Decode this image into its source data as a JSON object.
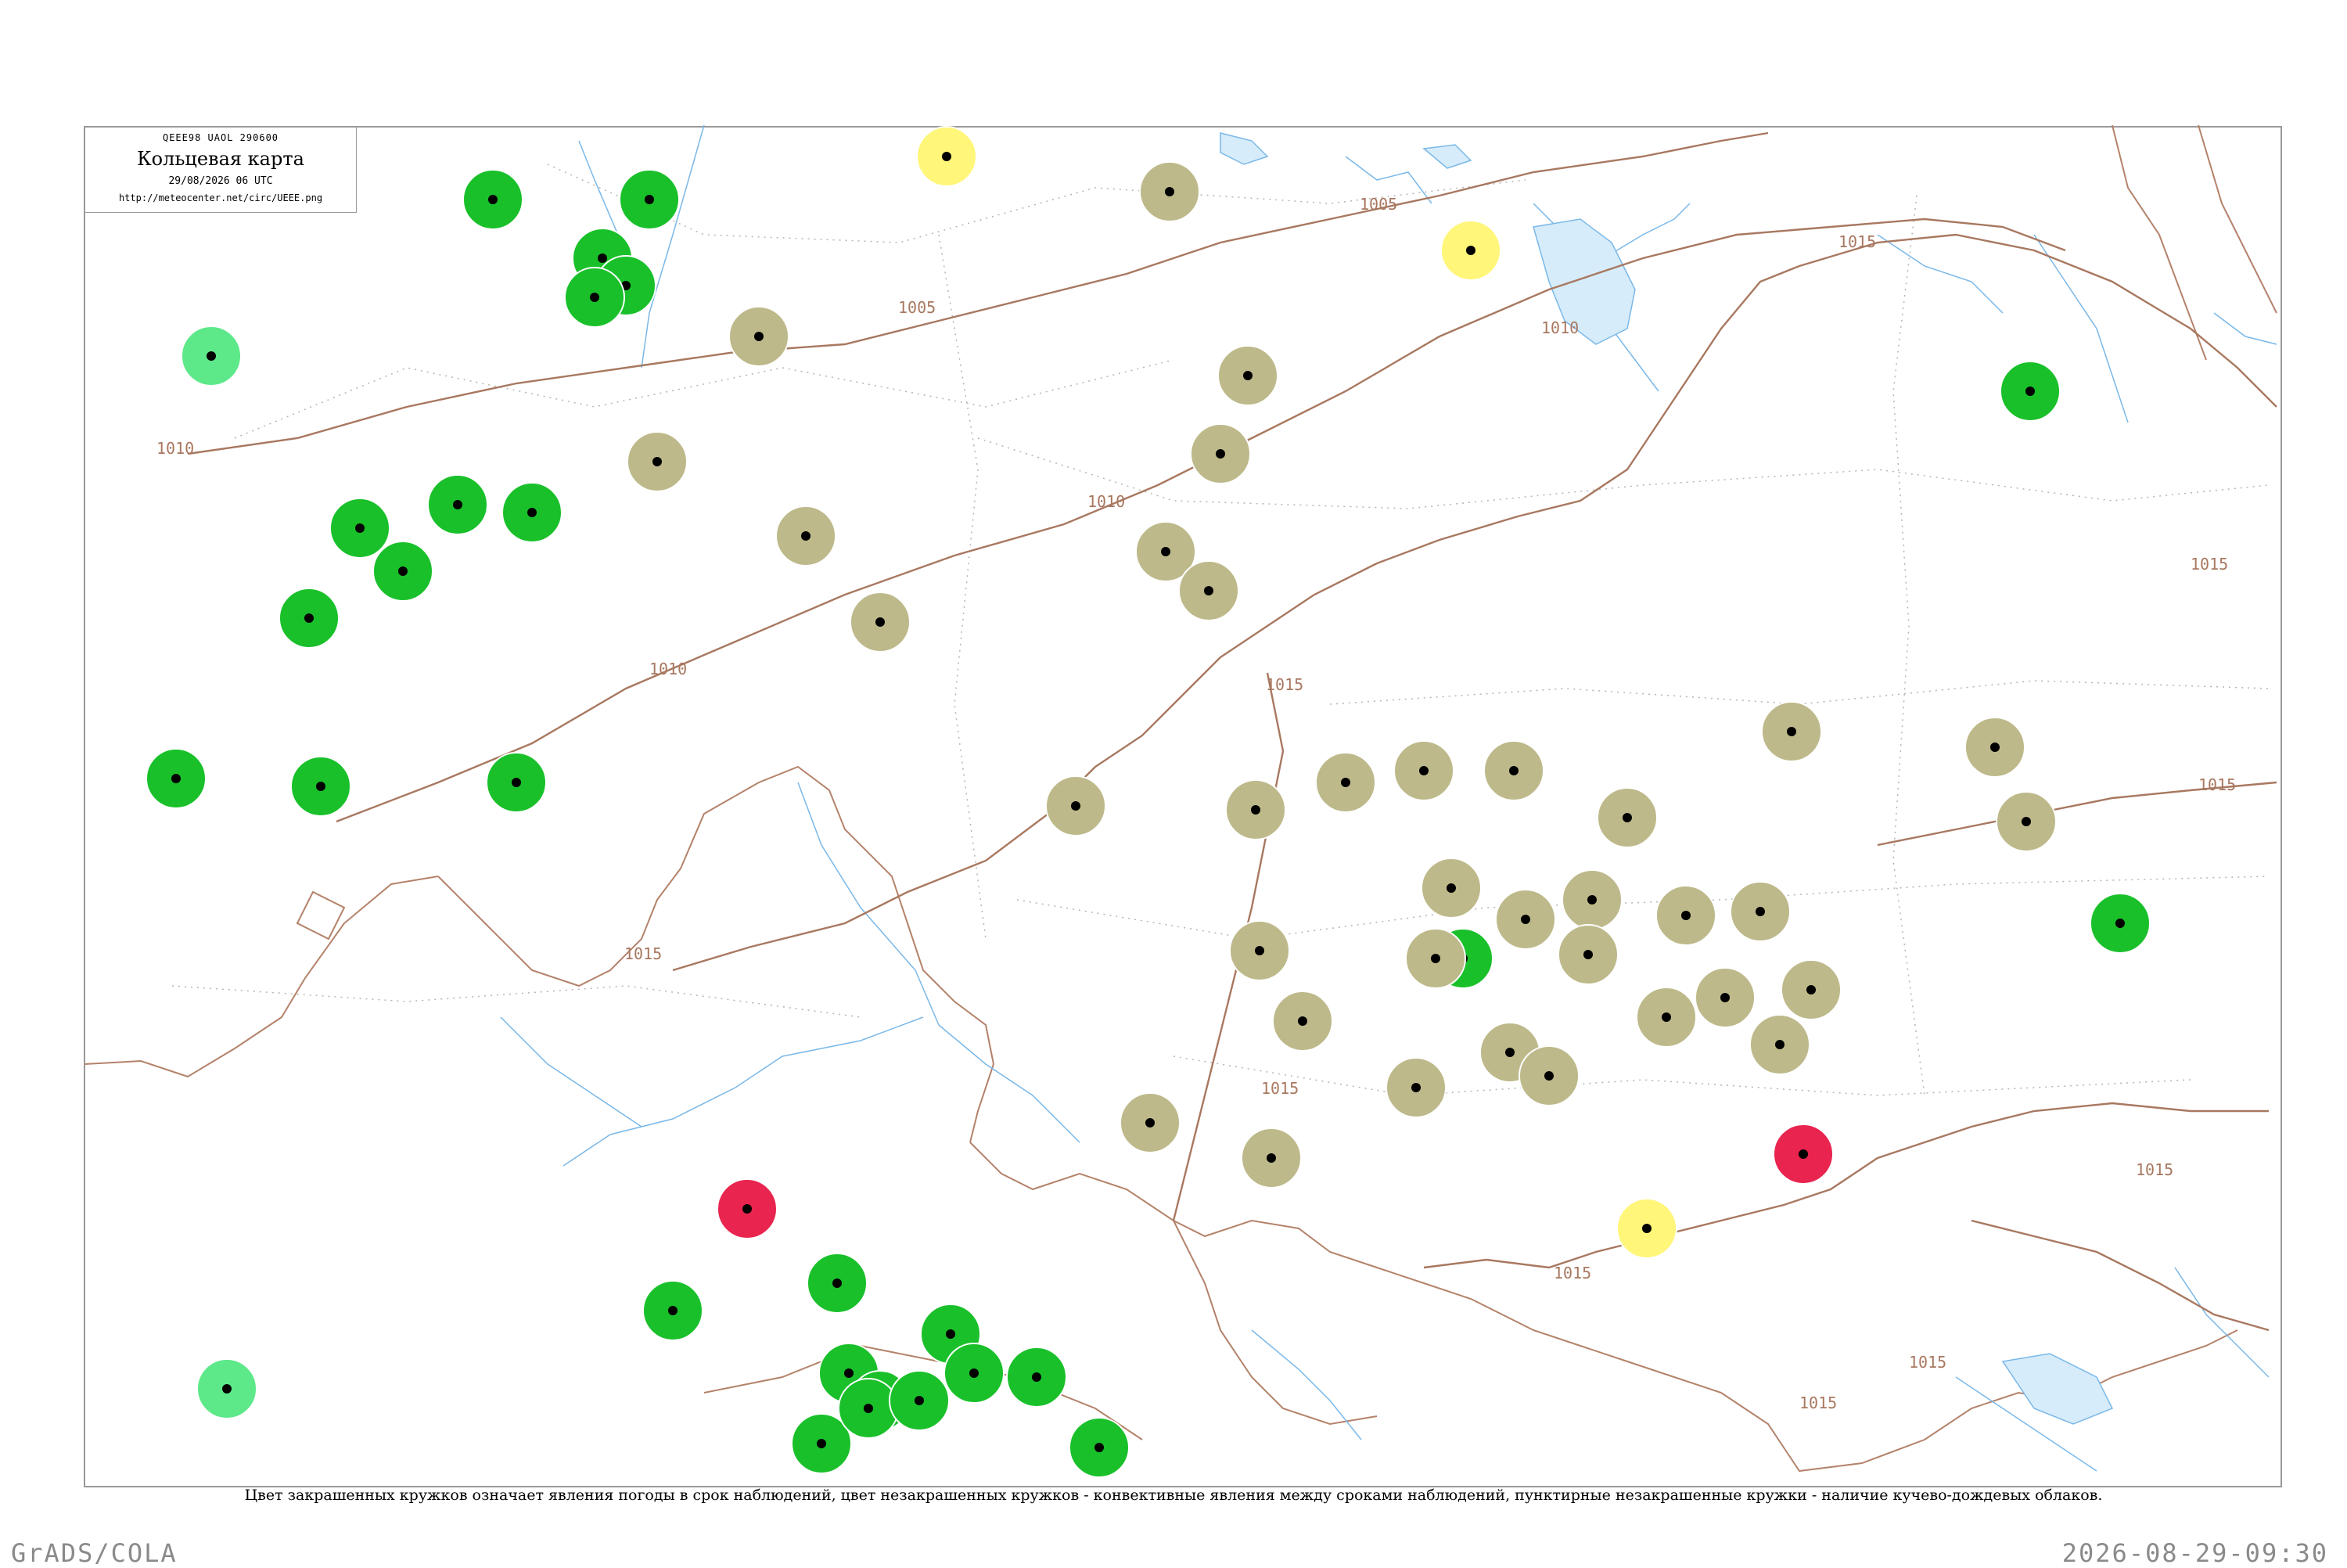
{
  "header": {
    "code": "QEEE98  UAOL  290600",
    "title": "Кольцевая карта",
    "time": "29/08/2026 06 UTC",
    "url": "http://meteocenter.net/circ/UEEE.png"
  },
  "caption": "Цвет закрашенных кружков означает явления погоды в срок наблюдений, цвет незакрашенных кружков - конвективные явления между сроками наблюдений, пунктирные незакрашенные кружки - наличие кучево-дождевых облаков.",
  "footer": {
    "left": "GrADS/COLA",
    "right": "2026-08-29-09:30"
  },
  "colors": {
    "rain": "#19c02a",
    "shower_light": "#5de88a",
    "fog_haze": "#bdb98a",
    "heat": "#fff67a",
    "severe": "#e8244f",
    "isobar": "#a87860",
    "river": "#7ab8e8",
    "border": "#a0a0a0"
  },
  "isobar_labels": [
    "1005",
    "1005",
    "1010",
    "1010",
    "1010",
    "1010",
    "1015",
    "1015",
    "1015",
    "1015",
    "1015",
    "1015",
    "1015",
    "1015",
    "1015",
    "1015"
  ],
  "stations": [
    {
      "kind": "rain",
      "t": "",
      "n": "",
      "name": ""
    },
    {
      "kind": "rain",
      "t": "",
      "n": "",
      "name": ""
    },
    {
      "kind": "rain",
      "t": "",
      "n": "",
      "name": ""
    },
    {
      "kind": "rain",
      "t": "",
      "n": "",
      "name": ""
    },
    {
      "kind": "rain",
      "t": "",
      "n": "",
      "name": ""
    },
    {
      "kind": "rain",
      "t": "",
      "n": "",
      "name": ""
    },
    {
      "kind": "rain",
      "t": "",
      "n": "",
      "name": ""
    },
    {
      "kind": "rain",
      "t": "",
      "n": "",
      "name": ""
    },
    {
      "kind": "rain",
      "t": "",
      "n": "",
      "name": ""
    },
    {
      "kind": "rain",
      "t": "",
      "n": "",
      "name": ""
    },
    {
      "kind": "rain",
      "t": "",
      "n": "",
      "name": ""
    },
    {
      "kind": "rain",
      "t": "",
      "n": "",
      "name": ""
    },
    {
      "kind": "rain",
      "t": "",
      "n": "",
      "name": ""
    },
    {
      "kind": "rain",
      "t": "",
      "n": "",
      "name": ""
    },
    {
      "kind": "rain",
      "t": "",
      "n": "",
      "name": ""
    },
    {
      "kind": "rain",
      "t": "",
      "n": "",
      "name": ""
    },
    {
      "kind": "rain",
      "t": "",
      "n": "",
      "name": ""
    },
    {
      "kind": "rain",
      "t": "",
      "n": "",
      "name": ""
    },
    {
      "kind": "rain",
      "t": "",
      "n": "",
      "name": ""
    },
    {
      "kind": "rain",
      "t": "",
      "n": "",
      "name": ""
    },
    {
      "kind": "rain",
      "t": "",
      "n": "",
      "name": ""
    },
    {
      "kind": "rain",
      "t": "",
      "n": "",
      "name": ""
    },
    {
      "kind": "rain",
      "t": "",
      "n": "",
      "name": ""
    },
    {
      "kind": "rain",
      "t": "",
      "n": "",
      "name": ""
    },
    {
      "kind": "rain",
      "t": "",
      "n": "",
      "name": ""
    },
    {
      "kind": "rain",
      "t": "",
      "n": "",
      "name": ""
    },
    {
      "kind": "rain",
      "t": "",
      "n": "",
      "name": ""
    },
    {
      "kind": "shower_light",
      "t": "",
      "n": "",
      "name": ""
    },
    {
      "kind": "shower_light",
      "t": "",
      "n": "",
      "name": ""
    },
    {
      "kind": "fog_haze",
      "t": "",
      "n": "",
      "name": ""
    },
    {
      "kind": "fog_haze",
      "t": "",
      "n": "",
      "name": ""
    },
    {
      "kind": "fog_haze",
      "t": "",
      "n": "",
      "name": ""
    },
    {
      "kind": "fog_haze",
      "t": "",
      "n": "",
      "name": ""
    },
    {
      "kind": "fog_haze",
      "t": "",
      "n": "",
      "name": ""
    },
    {
      "kind": "fog_haze",
      "t": "",
      "n": "",
      "name": ""
    },
    {
      "kind": "fog_haze",
      "t": "",
      "n": "",
      "name": ""
    },
    {
      "kind": "fog_haze",
      "t": "",
      "n": "",
      "name": ""
    },
    {
      "kind": "fog_haze",
      "t": "",
      "n": "",
      "name": ""
    },
    {
      "kind": "fog_haze",
      "t": "",
      "n": "",
      "name": ""
    },
    {
      "kind": "fog_haze",
      "t": "",
      "n": "",
      "name": ""
    },
    {
      "kind": "fog_haze",
      "t": "",
      "n": "",
      "name": ""
    },
    {
      "kind": "fog_haze",
      "t": "",
      "n": "",
      "name": ""
    },
    {
      "kind": "fog_haze",
      "t": "",
      "n": "",
      "name": ""
    },
    {
      "kind": "fog_haze",
      "t": "",
      "n": "",
      "name": ""
    },
    {
      "kind": "fog_haze",
      "t": "",
      "n": "",
      "name": ""
    },
    {
      "kind": "fog_haze",
      "t": "",
      "n": "",
      "name": ""
    },
    {
      "kind": "fog_haze",
      "t": "",
      "n": "",
      "name": ""
    },
    {
      "kind": "fog_haze",
      "t": "",
      "n": "",
      "name": ""
    },
    {
      "kind": "fog_haze",
      "t": "",
      "n": "",
      "name": ""
    },
    {
      "kind": "fog_haze",
      "t": "",
      "n": "",
      "name": ""
    },
    {
      "kind": "fog_haze",
      "t": "",
      "n": "",
      "name": ""
    },
    {
      "kind": "fog_haze",
      "t": "",
      "n": "",
      "name": ""
    },
    {
      "kind": "fog_haze",
      "t": "",
      "n": "",
      "name": ""
    },
    {
      "kind": "fog_haze",
      "t": "",
      "n": "",
      "name": ""
    },
    {
      "kind": "fog_haze",
      "t": "",
      "n": "",
      "name": ""
    },
    {
      "kind": "fog_haze",
      "t": "",
      "n": "",
      "name": ""
    },
    {
      "kind": "fog_haze",
      "t": "",
      "n": "",
      "name": ""
    },
    {
      "kind": "fog_haze",
      "t": "",
      "n": "",
      "name": ""
    },
    {
      "kind": "fog_haze",
      "t": "",
      "n": "",
      "name": ""
    },
    {
      "kind": "fog_haze",
      "t": "",
      "n": "",
      "name": ""
    },
    {
      "kind": "fog_haze",
      "t": "",
      "n": "",
      "name": ""
    },
    {
      "kind": "fog_haze",
      "t": "",
      "n": "",
      "name": ""
    },
    {
      "kind": "fog_haze",
      "t": "",
      "n": "",
      "name": ""
    },
    {
      "kind": "fog_haze",
      "t": "",
      "n": "",
      "name": ""
    },
    {
      "kind": "fog_haze",
      "t": "",
      "n": "",
      "name": ""
    },
    {
      "kind": "heat",
      "t": "",
      "n": "",
      "name": ""
    },
    {
      "kind": "heat",
      "t": "",
      "n": "",
      "name": ""
    },
    {
      "kind": "heat",
      "t": "",
      "n": "",
      "name": ""
    },
    {
      "kind": "severe",
      "t": "",
      "n": "",
      "name": ""
    },
    {
      "kind": "severe",
      "t": "",
      "n": "",
      "name": ""
    }
  ]
}
